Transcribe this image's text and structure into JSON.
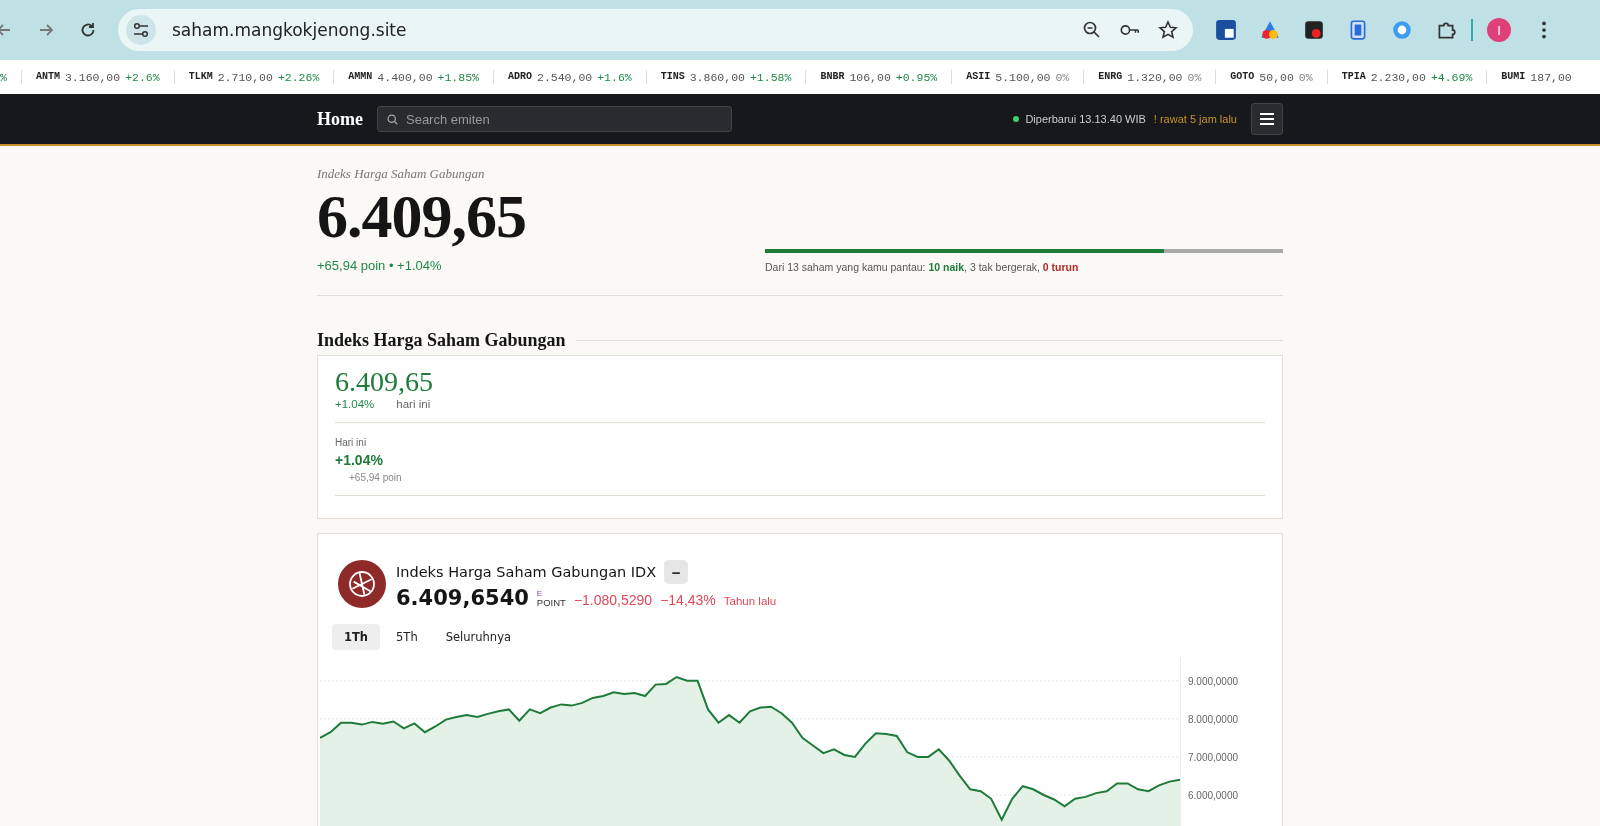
{
  "browser": {
    "url": "saham.mangkokjenong.site",
    "profile_initial": "I"
  },
  "ticker": [
    {
      "change": "%",
      "kind": "up"
    },
    {
      "symbol": "ANTM",
      "price": "3.160,00",
      "change": "+2.6%",
      "kind": "up"
    },
    {
      "symbol": "TLKM",
      "price": "2.710,00",
      "change": "+2.26%",
      "kind": "up"
    },
    {
      "symbol": "AMMN",
      "price": "4.400,00",
      "change": "+1.85%",
      "kind": "up"
    },
    {
      "symbol": "ADRO",
      "price": "2.540,00",
      "change": "+1.6%",
      "kind": "up"
    },
    {
      "symbol": "TINS",
      "price": "3.860,00",
      "change": "+1.58%",
      "kind": "up"
    },
    {
      "symbol": "BNBR",
      "price": "106,00",
      "change": "+0.95%",
      "kind": "up"
    },
    {
      "symbol": "ASII",
      "price": "5.100,00",
      "change": "0%",
      "kind": "flat"
    },
    {
      "symbol": "ENRG",
      "price": "1.320,00",
      "change": "0%",
      "kind": "flat"
    },
    {
      "symbol": "GOTO",
      "price": "50,00",
      "change": "0%",
      "kind": "flat"
    },
    {
      "symbol": "TPIA",
      "price": "2.230,00",
      "change": "+4.69%",
      "kind": "up"
    },
    {
      "symbol": "BUMI",
      "price": "187,00"
    }
  ],
  "nav": {
    "brand": "Home",
    "search_placeholder": "Search emiten",
    "updated": "Diperbarui 13.13.40 WIB",
    "stale_note": "! rawat 5 jam lalu"
  },
  "hero": {
    "label": "Indeks Harga Saham Gabungan",
    "value": "6.409,65",
    "change": "+65,94 poin • +1.04%",
    "breadth": {
      "level": 0.77,
      "parts": [
        {
          "kind": "plain",
          "text": "Dari 13 saham yang kamu pantau: "
        },
        {
          "kind": "up",
          "text": "10 naik"
        },
        {
          "kind": "plain",
          "text": ", 3 tak bergerak, "
        },
        {
          "kind": "down",
          "text": "0 turun"
        }
      ]
    }
  },
  "section": {
    "title": "Indeks Harga Saham Gabungan",
    "value": "6.409,65",
    "change": "+1.04%",
    "period": "hari ini",
    "today_label": "Hari ini",
    "today_change": "+1.04%",
    "today_points": "+65,94 poin"
  },
  "widget": {
    "title": "Indeks Harga Saham Gabungan IDX",
    "badge": "−",
    "price": "6.409,6540",
    "exchange_mark": "E",
    "unit": "POINT",
    "change": "−1.080,5290",
    "change_pct": "−14,43%",
    "period": "Tahun lalu",
    "tabs": [
      {
        "label": "1Th",
        "selected": true
      },
      {
        "label": "5Th",
        "selected": false
      },
      {
        "label": "Seluruhnya",
        "selected": false
      }
    ],
    "chart_data": {
      "type": "area",
      "grid": true,
      "ylim": [
        5000,
        9600
      ],
      "yticks": [
        {
          "value": 6000,
          "label": "6.000,0000"
        },
        {
          "value": 7000,
          "label": "7.000,0000"
        },
        {
          "value": 8000,
          "label": "8.000,0000"
        },
        {
          "value": 9000,
          "label": "9.000,0000"
        }
      ],
      "series": [
        {
          "color": "#1e7b3a",
          "values": [
            7500,
            7650,
            7900,
            7900,
            7850,
            7920,
            7870,
            7930,
            7750,
            7880,
            7650,
            7800,
            7980,
            8050,
            8100,
            8050,
            8130,
            8200,
            8250,
            7950,
            8250,
            8150,
            8300,
            8380,
            8350,
            8420,
            8550,
            8600,
            8700,
            8650,
            8680,
            8600,
            8900,
            8920,
            9100,
            9000,
            9000,
            8250,
            7900,
            8100,
            7900,
            8200,
            8300,
            8320,
            8150,
            7900,
            7500,
            7300,
            7100,
            7200,
            7050,
            7000,
            7350,
            7620,
            7600,
            7550,
            7120,
            7000,
            7000,
            7200,
            6900,
            6500,
            6150,
            6100,
            5900,
            5350,
            5900,
            6230,
            6150,
            6000,
            5880,
            5700,
            5900,
            5950,
            6050,
            6100,
            6300,
            6300,
            6150,
            6100,
            6250,
            6350,
            6400
          ]
        }
      ]
    }
  }
}
